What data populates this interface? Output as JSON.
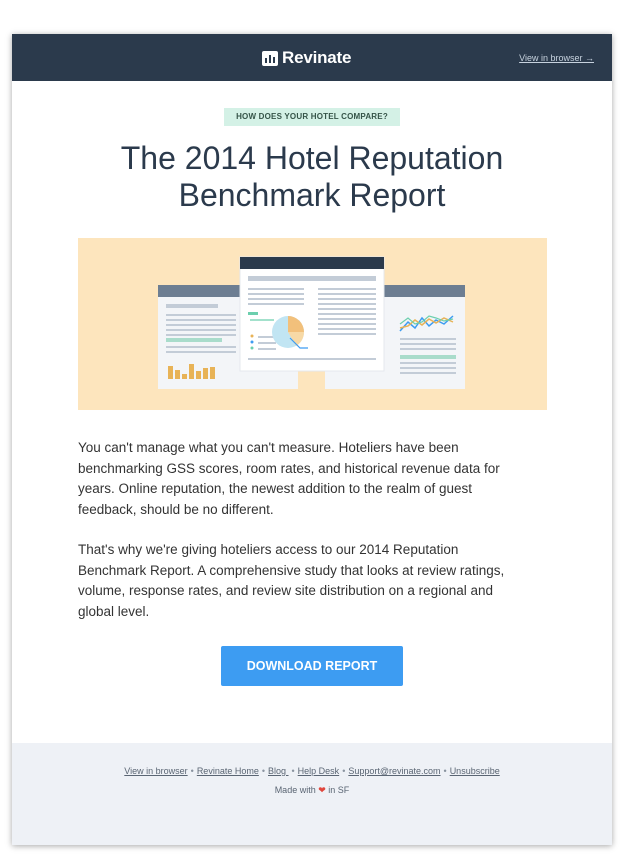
{
  "header": {
    "logo_text": "Revinate",
    "view_in_browser": "View in browser →"
  },
  "main": {
    "tag": "HOW DOES YOUR HOTEL COMPARE?",
    "headline_line1": "The 2014 Hotel Reputation",
    "headline_line2": "Benchmark Report",
    "hero_illustration": "report-dashboard-illustration",
    "paragraph1": "You can't manage what you can't measure. Hoteliers have been benchmarking GSS scores, room rates, and historical revenue data for years. Online reputation, the newest addition to the realm of guest feedback, should be no different.",
    "paragraph2": "That's why we're giving hoteliers access to our 2014 Reputation Benchmark Report. A comprehensive study that looks at review ratings, volume, response rates, and review site distribution on a regional and global level.",
    "cta_label": "DOWNLOAD REPORT"
  },
  "footer": {
    "links": [
      "View in browser",
      "Revinate Home",
      "Blog ",
      "Help Desk",
      "Support@revinate.com",
      "Unsubscribe"
    ],
    "separator": "•",
    "made_with_prefix": "Made with",
    "made_with_suffix": "in SF",
    "heart_icon": "heart-icon"
  },
  "colors": {
    "header_bg": "#2b3a4c",
    "tag_bg": "#d4f1e6",
    "hero_bg": "#fde5bd",
    "cta_bg": "#3d9cf2",
    "footer_bg": "#eef1f6",
    "heart": "#e0463c"
  }
}
